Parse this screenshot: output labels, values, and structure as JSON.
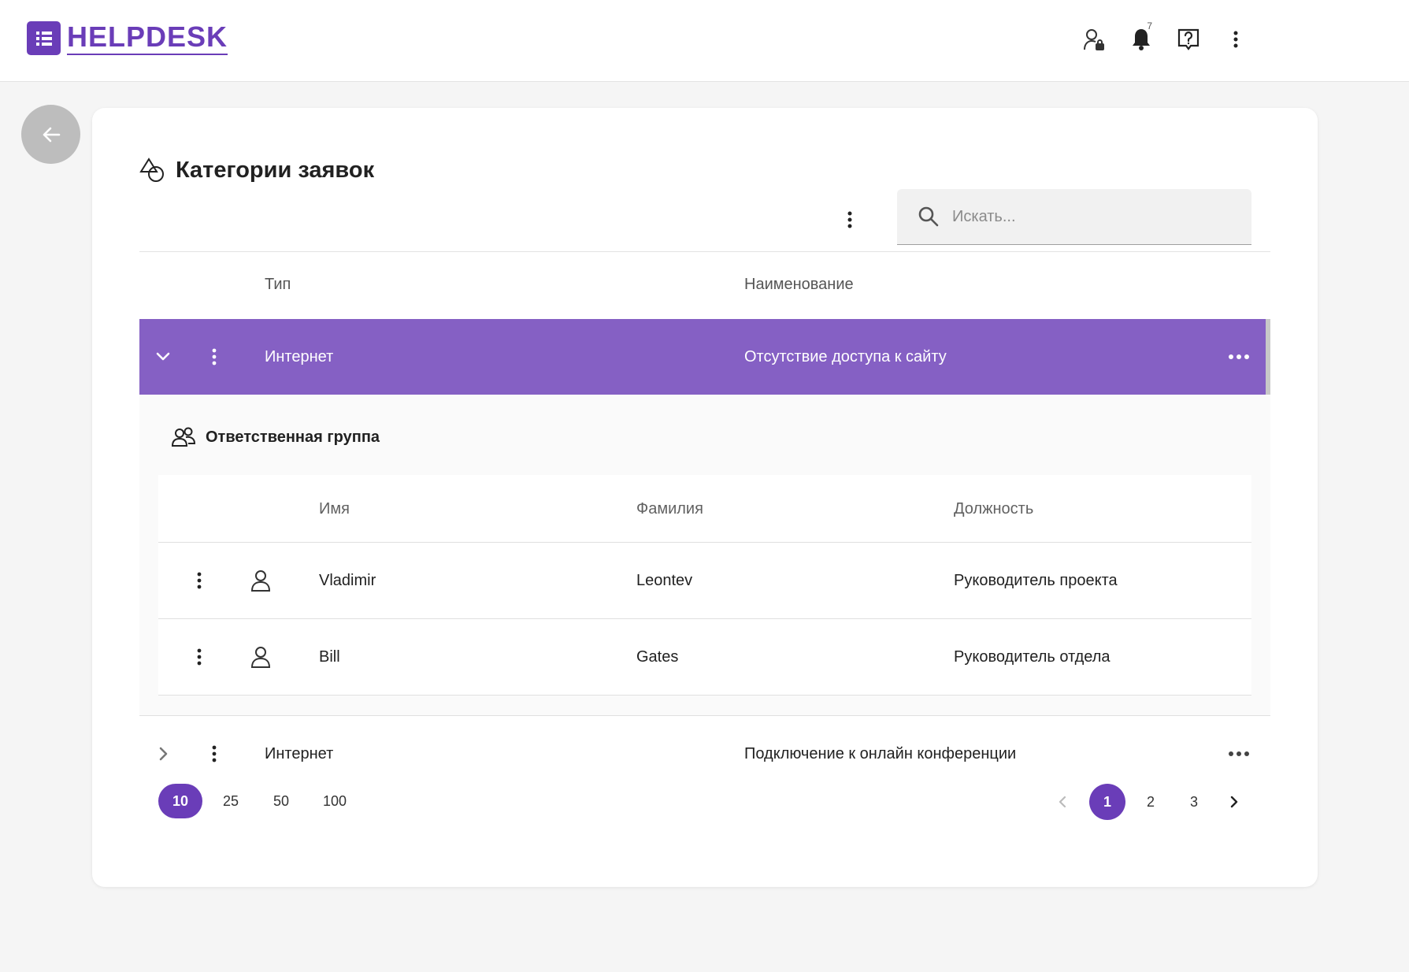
{
  "app": {
    "logo_text": "HELPDESK"
  },
  "header": {
    "notification_count": "7"
  },
  "page": {
    "title": "Категории заявок"
  },
  "search": {
    "placeholder": "Искать..."
  },
  "table": {
    "columns": {
      "type": "Тип",
      "name": "Наименование"
    },
    "rows": [
      {
        "type": "Интернет",
        "name": "Отсутствие доступа к сайту",
        "expanded": true
      },
      {
        "type": "Интернет",
        "name": "Подключение к онлайн конференции",
        "expanded": false
      }
    ]
  },
  "group": {
    "title": "Ответственная группа",
    "columns": {
      "first_name": "Имя",
      "last_name": "Фамилия",
      "position": "Должность"
    },
    "members": [
      {
        "first_name": "Vladimir",
        "last_name": "Leontev",
        "position": "Руководитель проекта"
      },
      {
        "first_name": "Bill",
        "last_name": "Gates",
        "position": "Руководитель отдела"
      }
    ]
  },
  "pagination": {
    "page_sizes": [
      "10",
      "25",
      "50",
      "100"
    ],
    "active_size": "10",
    "pages": [
      "1",
      "2",
      "3"
    ],
    "active_page": "1"
  },
  "colors": {
    "accent": "#6a3db8",
    "row_selected": "#8560c4"
  }
}
